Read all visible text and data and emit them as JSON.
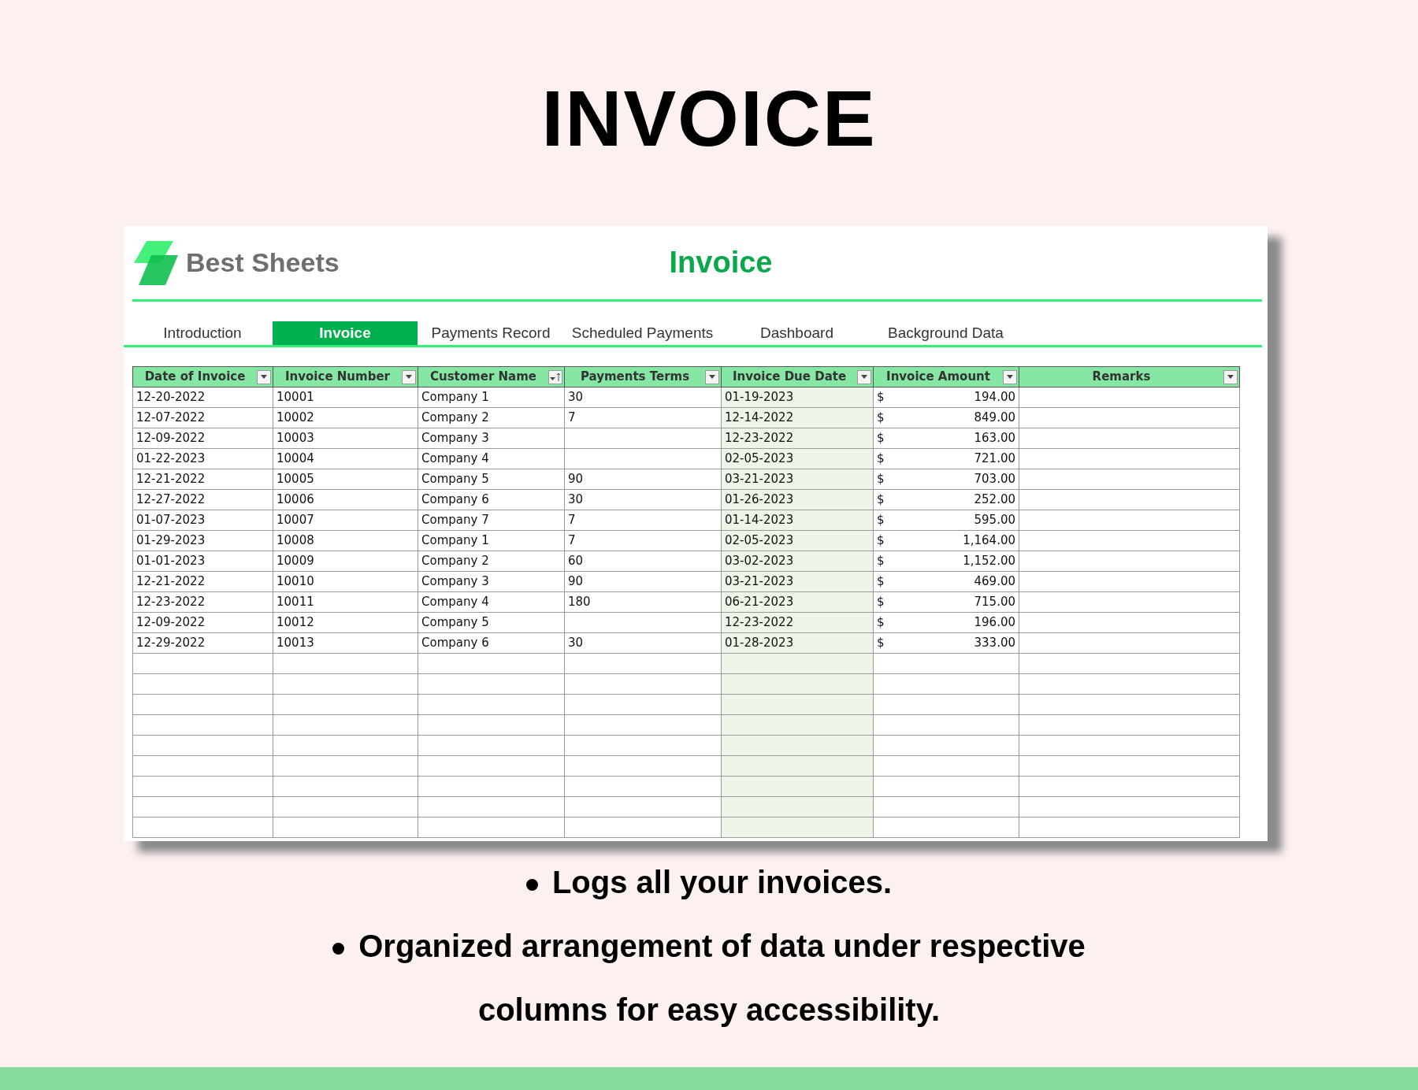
{
  "title": "INVOICE",
  "window": {
    "brand": "Best Sheets",
    "heading": "Invoice",
    "tabs": [
      {
        "label": "Introduction",
        "selected": false
      },
      {
        "label": "Invoice",
        "selected": true
      },
      {
        "label": "Payments Record",
        "selected": false
      },
      {
        "label": "Scheduled Payments",
        "selected": false
      },
      {
        "label": "Dashboard",
        "selected": false
      },
      {
        "label": "Background Data",
        "selected": false
      }
    ],
    "table": {
      "columns": [
        {
          "label": "Date of Invoice",
          "kind": "dropdown",
          "highlighted": false
        },
        {
          "label": "Invoice Number",
          "kind": "dropdown",
          "highlighted": false
        },
        {
          "label": "Customer Name",
          "kind": "sorted",
          "highlighted": false
        },
        {
          "label": "Payments Terms",
          "kind": "dropdown",
          "highlighted": false
        },
        {
          "label": "Invoice Due Date",
          "kind": "dropdown",
          "highlighted": true
        },
        {
          "label": "Invoice Amount",
          "kind": "dropdown",
          "highlighted": false
        },
        {
          "label": "Remarks",
          "kind": "dropdown",
          "highlighted": false
        }
      ],
      "rows": [
        {
          "date": "12-20-2022",
          "number": "10001",
          "customer": "Company 1",
          "terms": "30",
          "due": "01-19-2023",
          "currency": "$",
          "amount": "194.00"
        },
        {
          "date": "12-07-2022",
          "number": "10002",
          "customer": "Company 2",
          "terms": "7",
          "due": "12-14-2022",
          "currency": "$",
          "amount": "849.00"
        },
        {
          "date": "12-09-2022",
          "number": "10003",
          "customer": "Company 3",
          "due": "12-23-2022",
          "currency": "$",
          "amount": "163.00"
        },
        {
          "date": "01-22-2023",
          "number": "10004",
          "customer": "Company 4",
          "due": "02-05-2023",
          "currency": "$",
          "amount": "721.00"
        },
        {
          "date": "12-21-2022",
          "number": "10005",
          "customer": "Company 5",
          "terms": "90",
          "due": "03-21-2023",
          "currency": "$",
          "amount": "703.00"
        },
        {
          "date": "12-27-2022",
          "number": "10006",
          "customer": "Company 6",
          "terms": "30",
          "due": "01-26-2023",
          "currency": "$",
          "amount": "252.00"
        },
        {
          "date": "01-07-2023",
          "number": "10007",
          "customer": "Company 7",
          "terms": "7",
          "due": "01-14-2023",
          "currency": "$",
          "amount": "595.00"
        },
        {
          "date": "01-29-2023",
          "number": "10008",
          "customer": "Company 1",
          "terms": "7",
          "due": "02-05-2023",
          "currency": "$",
          "amount": "1,164.00"
        },
        {
          "date": "01-01-2023",
          "number": "10009",
          "customer": "Company 2",
          "terms": "60",
          "due": "03-02-2023",
          "currency": "$",
          "amount": "1,152.00"
        },
        {
          "date": "12-21-2022",
          "number": "10010",
          "customer": "Company 3",
          "terms": "90",
          "due": "03-21-2023",
          "currency": "$",
          "amount": "469.00"
        },
        {
          "date": "12-23-2022",
          "number": "10011",
          "customer": "Company 4",
          "terms": "180",
          "due": "06-21-2023",
          "currency": "$",
          "amount": "715.00"
        },
        {
          "date": "12-09-2022",
          "number": "10012",
          "customer": "Company 5",
          "due": "12-23-2022",
          "currency": "$",
          "amount": "196.00"
        },
        {
          "date": "12-29-2022",
          "number": "10013",
          "customer": "Company 6",
          "terms": "30",
          "due": "01-28-2023",
          "currency": "$",
          "amount": "333.00"
        }
      ]
    }
  },
  "bullets": [
    "Logs all your invoices.",
    "Organized arrangement of data under respective columns for easy accessibility."
  ]
}
